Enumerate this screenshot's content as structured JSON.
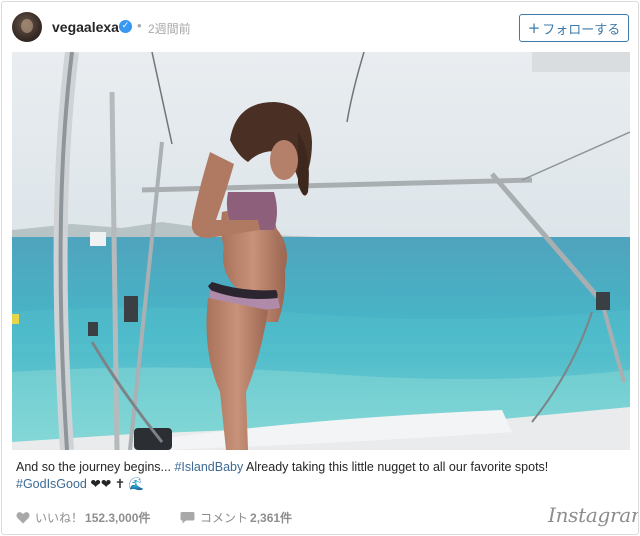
{
  "post": {
    "username": "vegaalexa",
    "separator": "•",
    "time_ago": "2週間前",
    "follow_label": "フォローする",
    "follow_plus": "+"
  },
  "caption": {
    "text_1": "And so the journey begins... ",
    "hashtag_1": "#IslandBaby",
    "text_2": " Already taking this little nugget to all our favorite spots!",
    "hashtag_2": "#GodIsGood",
    "emojis": " ❤❤ ✝ 🌊"
  },
  "footer": {
    "likes_label": "いいね！",
    "likes_count": "152.3,000件",
    "comments_label": "コメント",
    "comments_count": "2,361件",
    "brand": "Instagram"
  },
  "colors": {
    "accent": "#3d7aa8",
    "verified": "#3897f0",
    "hashtag": "#3d6a94",
    "meta_gray": "#8e8e8e"
  },
  "icons": [
    "verified-badge-icon",
    "plus-icon",
    "heart-icon",
    "comment-bubble-icon",
    "instagram-logo"
  ]
}
